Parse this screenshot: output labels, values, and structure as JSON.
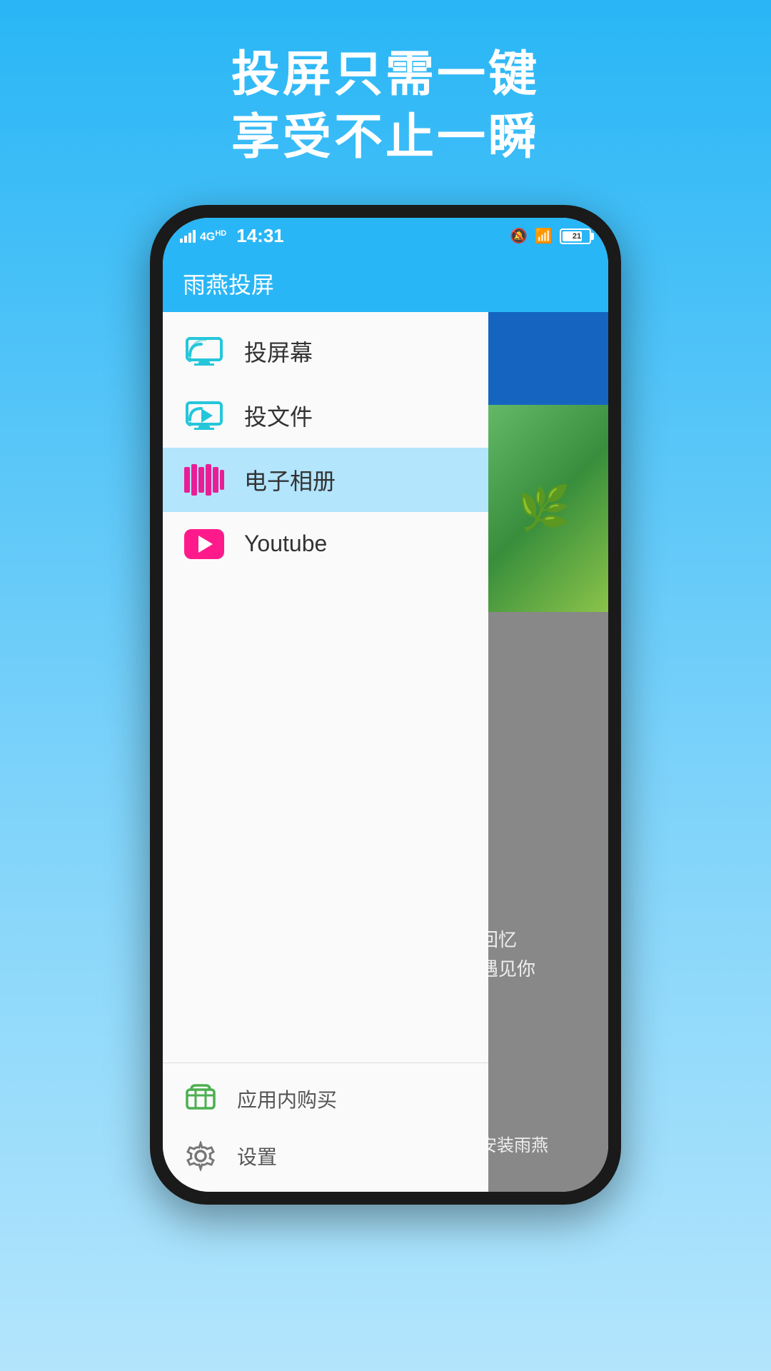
{
  "background": {
    "gradient_start": "#29b6f6",
    "gradient_end": "#b3e5fc"
  },
  "header_text": {
    "line1": "投屏只需一键",
    "line2": "享受不止一瞬"
  },
  "status_bar": {
    "signal": "4G",
    "time": "14:31",
    "battery": "21"
  },
  "app_bar": {
    "title": "雨燕投屏"
  },
  "menu_items": [
    {
      "id": "cast-screen",
      "label": "投屏幕",
      "icon": "cast-screen-icon",
      "active": false
    },
    {
      "id": "cast-file",
      "label": "投文件",
      "icon": "cast-file-icon",
      "active": false
    },
    {
      "id": "photo-album",
      "label": "电子相册",
      "icon": "photo-icon",
      "active": true
    },
    {
      "id": "youtube",
      "label": "Youtube",
      "icon": "youtube-icon",
      "active": false
    }
  ],
  "bottom_items": [
    {
      "id": "purchase",
      "label": "应用内购买",
      "icon": "cart-icon"
    },
    {
      "id": "settings",
      "label": "设置",
      "icon": "gear-icon"
    }
  ],
  "right_panel": {
    "text1": "回忆",
    "text2": "遇见你",
    "install_text": "安装雨燕"
  }
}
